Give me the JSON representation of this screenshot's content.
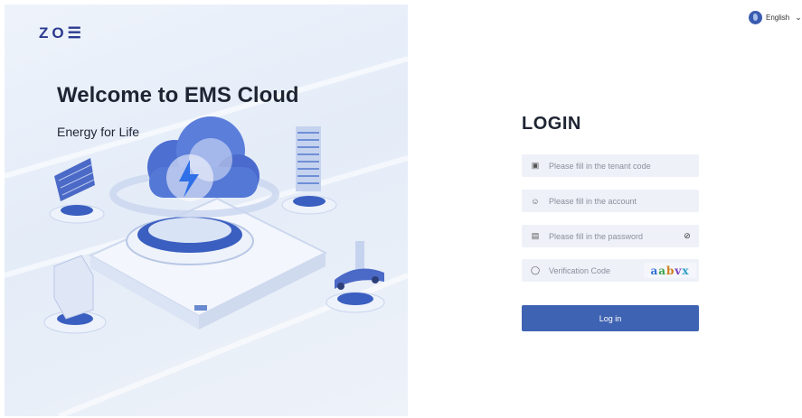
{
  "brand": {
    "logo_text": "ZO☰"
  },
  "hero": {
    "title": "Welcome to EMS Cloud",
    "subtitle": "Energy for Life"
  },
  "language": {
    "label": "English",
    "icon": "globe-icon"
  },
  "login": {
    "title": "LOGIN",
    "fields": {
      "tenant": {
        "placeholder": "Please fill in the tenant code",
        "icon": "tenant-icon"
      },
      "account": {
        "placeholder": "Please fill in the account",
        "icon": "user-icon"
      },
      "password": {
        "placeholder": "Please fill in the password",
        "icon": "lock-icon",
        "toggle_icon": "eye-off-icon"
      },
      "code": {
        "placeholder": "Verification Code",
        "icon": "shield-icon"
      }
    },
    "captcha": [
      "a",
      "a",
      "b",
      "v",
      "x"
    ],
    "submit_label": "Log in"
  },
  "colors": {
    "accent": "#3f63b3",
    "field_bg": "#eef1f8",
    "hero_bg": "#e8eef9"
  }
}
